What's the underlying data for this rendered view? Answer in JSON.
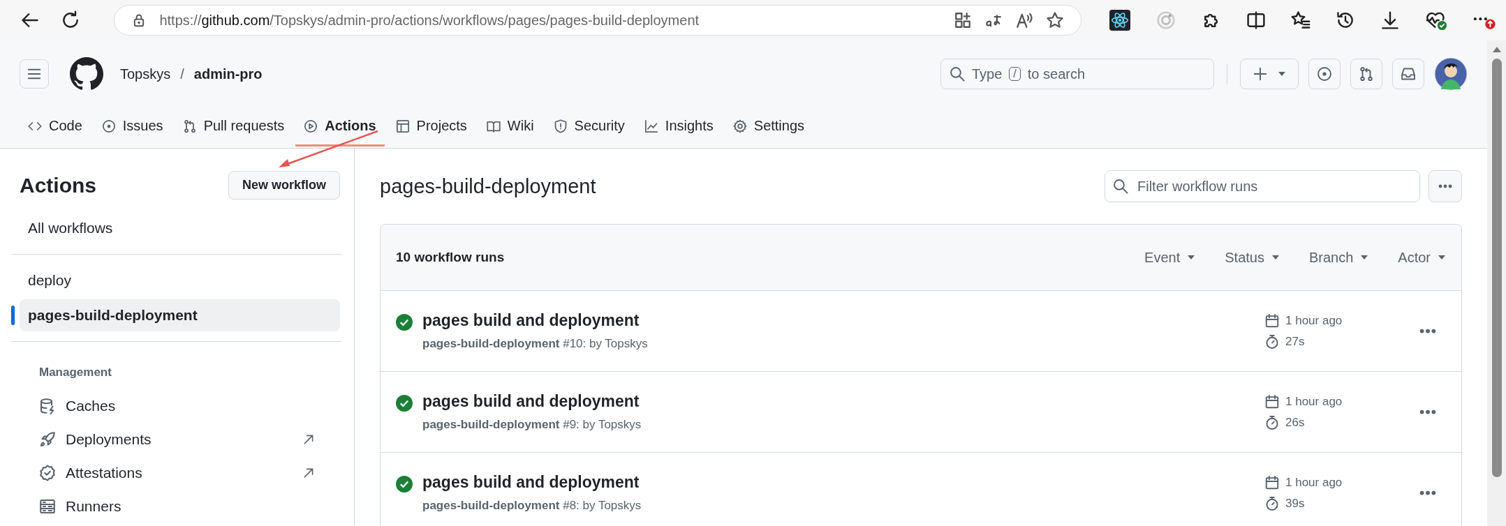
{
  "browser": {
    "url": {
      "scheme": "https://",
      "host": "github.com",
      "path": "/Topskys/admin-pro/actions/workflows/pages/pages-build-deployment"
    }
  },
  "header": {
    "owner": "Topskys",
    "separator": "/",
    "repo": "admin-pro",
    "search": {
      "before": "Type",
      "key": "/",
      "after": "to search"
    },
    "tabs": [
      {
        "label": "Code",
        "selected": false
      },
      {
        "label": "Issues",
        "selected": false
      },
      {
        "label": "Pull requests",
        "selected": false
      },
      {
        "label": "Actions",
        "selected": true
      },
      {
        "label": "Projects",
        "selected": false
      },
      {
        "label": "Wiki",
        "selected": false
      },
      {
        "label": "Security",
        "selected": false
      },
      {
        "label": "Insights",
        "selected": false
      },
      {
        "label": "Settings",
        "selected": false
      }
    ]
  },
  "sidebar": {
    "title": "Actions",
    "new_button": "New workflow",
    "all_item": {
      "label": "All workflows",
      "selected": false
    },
    "workflows": [
      {
        "label": "deploy",
        "selected": false
      },
      {
        "label": "pages-build-deployment",
        "selected": true
      }
    ],
    "section_title": "Management",
    "management": [
      {
        "label": "Caches",
        "external": false
      },
      {
        "label": "Deployments",
        "external": true
      },
      {
        "label": "Attestations",
        "external": true
      },
      {
        "label": "Runners",
        "external": false
      }
    ]
  },
  "main": {
    "title": "pages-build-deployment",
    "filter": {
      "placeholder": "Filter workflow runs"
    },
    "count": "10 workflow runs",
    "filters": [
      "Event",
      "Status",
      "Branch",
      "Actor"
    ],
    "runs": [
      {
        "kind": "success",
        "title": "pages build and deployment",
        "subtitle": "**pages-build-deployment** #10: by Topskys",
        "time": "1 hour ago",
        "duration": "27s"
      },
      {
        "kind": "success",
        "title": "pages build and deployment",
        "subtitle": "**pages-build-deployment** #9: by Topskys",
        "time": "1 hour ago",
        "duration": "26s"
      },
      {
        "kind": "success",
        "title": "pages build and deployment",
        "subtitle": "**pages-build-deployment** #8: by Topskys",
        "time": "1 hour ago",
        "duration": "39s"
      }
    ]
  }
}
